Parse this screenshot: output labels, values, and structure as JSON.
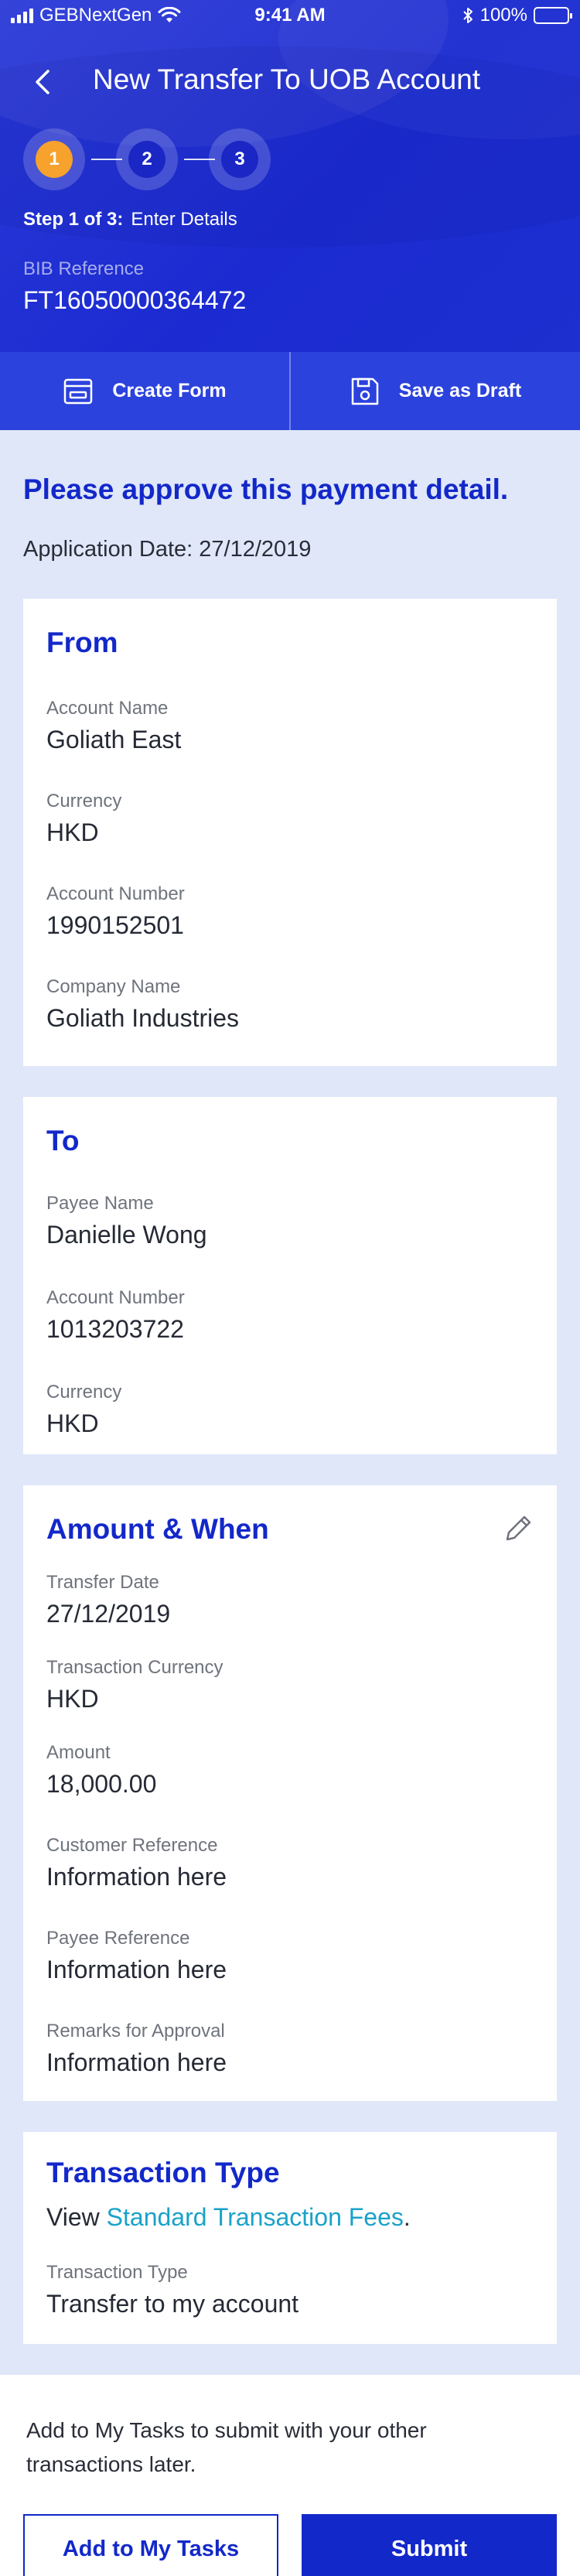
{
  "status_bar": {
    "carrier": "GEBNextGen",
    "time": "9:41 AM",
    "battery": "100%",
    "icons": [
      "signal-icon",
      "wifi-icon",
      "bluetooth-icon",
      "battery-icon"
    ]
  },
  "nav": {
    "title": "New Transfer To UOB Account",
    "back_icon": "chevron-left-icon"
  },
  "stepper": {
    "steps": [
      "1",
      "2",
      "3"
    ],
    "current_index": 0,
    "caption_bold": "Step 1 of 3:",
    "caption_text": "Enter Details"
  },
  "reference": {
    "label": "BIB Reference",
    "value": "FT16050000364472"
  },
  "actions": {
    "create_form": "Create Form",
    "save_draft": "Save as Draft"
  },
  "intro": {
    "heading": "Please approve this payment detail.",
    "application_date": "Application Date: 27/12/2019"
  },
  "from": {
    "title": "From",
    "fields": [
      {
        "label": "Account Name",
        "value": "Goliath East"
      },
      {
        "label": "Currency",
        "value": "HKD"
      },
      {
        "label": "Account Number",
        "value": "1990152501"
      },
      {
        "label": "Company Name",
        "value": "Goliath Industries"
      }
    ]
  },
  "to": {
    "title": "To",
    "fields": [
      {
        "label": "Payee Name",
        "value": "Danielle Wong"
      },
      {
        "label": "Account Number",
        "value": "1013203722"
      },
      {
        "label": "Currency",
        "value": "HKD"
      }
    ]
  },
  "amount_when": {
    "title": "Amount & When",
    "edit_icon": "pencil-icon",
    "fields": [
      {
        "label": "Transfer Date",
        "value": "27/12/2019"
      },
      {
        "label": "Transaction Currency",
        "value": "HKD"
      },
      {
        "label": "Amount",
        "value": "18,000.00"
      },
      {
        "label": "Customer Reference",
        "value": "Information here"
      },
      {
        "label": "Payee Reference",
        "value": "Information here"
      },
      {
        "label": "Remarks for Approval",
        "value": "Information here"
      }
    ]
  },
  "transaction_type": {
    "title": "Transaction Type",
    "view_prefix": "View ",
    "link_text": "Standard Transaction Fees",
    "view_suffix": ".",
    "field_label": "Transaction Type",
    "field_value": "Transfer to my account"
  },
  "footer": {
    "note": "Add to My Tasks to submit with your other transactions later.",
    "add_tasks": "Add to My Tasks",
    "submit": "Submit"
  },
  "colors": {
    "brand_blue": "#1328c9",
    "active_step": "#f6a22c",
    "link": "#1aa2c9",
    "background": "#dfe7f9"
  }
}
